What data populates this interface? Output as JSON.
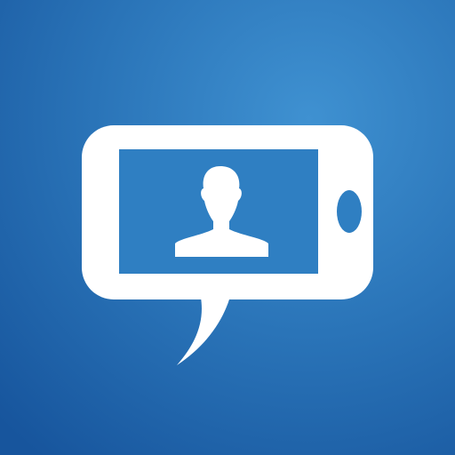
{
  "icon": {
    "name": "video-call-chat-icon",
    "background": {
      "gradient_center": "#3f91d1",
      "gradient_mid": "#2a74b8",
      "gradient_edge": "#17559d"
    },
    "foreground_color": "#ffffff",
    "screen_color": "#2f7fc2",
    "glyphs": [
      "speech-bubble-icon",
      "phone-landscape-icon",
      "person-silhouette-icon",
      "home-button-icon"
    ]
  }
}
